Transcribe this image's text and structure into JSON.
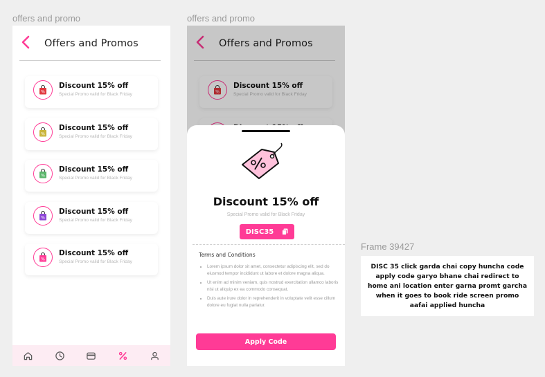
{
  "frames": {
    "left_label": "offers and promo",
    "middle_label": "offers and promo",
    "note_label": "Frame 39427"
  },
  "header": {
    "title": "Offers and Promos"
  },
  "promos": [
    {
      "title": "Discount 15% off",
      "subtitle": "Special Promo valid for Black Friday",
      "bag_color": "#e0383d",
      "bag_icon": "shopping-bag-icon"
    },
    {
      "title": "Discount 15% off",
      "subtitle": "Special Promo valid for Black Friday",
      "bag_color": "#c9b43a",
      "bag_icon": "shopping-bag-icon"
    },
    {
      "title": "Discount 15% off",
      "subtitle": "Special Promo valid for Black Friday",
      "bag_color": "#59b56a",
      "bag_icon": "shopping-bag-icon"
    },
    {
      "title": "Discount 15% off",
      "subtitle": "Special Promo valid for Black Friday",
      "bag_color": "#8e47d6",
      "bag_icon": "shopping-bag-icon"
    },
    {
      "title": "Discount 15% off",
      "subtitle": "Special Promo valid for Black Friday",
      "bag_color": "#ff3b96",
      "bag_icon": "shopping-bag-icon"
    }
  ],
  "bottom_nav": [
    {
      "icon": "home-icon",
      "active": false
    },
    {
      "icon": "clock-icon",
      "active": false
    },
    {
      "icon": "wallet-icon",
      "active": false
    },
    {
      "icon": "percent-icon",
      "active": true
    },
    {
      "icon": "profile-icon",
      "active": false
    }
  ],
  "sheet": {
    "icon": "discount-tag-icon",
    "title": "Discount 15% off",
    "subtitle": "Special Promo valid for Black Friday",
    "code": "DISC35",
    "terms_title": "Terms and Conditions",
    "terms": [
      "Lorem ipsum dolor sit amet, consectetur adipiscing elit, sed do eiusmod tempor incididunt ut labore et dolore magna aliqua.",
      "Ut enim ad minim veniam, quis nostrud exercitation ullamco laboris nisi ut aliquip ex ea commodo consequat.",
      "Duis aute irure dolor in reprehenderit in voluptate velit esse cillum dolore eu fugiat nulla pariatur."
    ],
    "apply_label": "Apply Code"
  },
  "note": {
    "text": "DISC 35 click garda chai copy huncha code apply code garyo bhane chai redirect to home ani location enter garna promt garcha when it goes to book ride screen promo aafai applied huncha"
  },
  "colors": {
    "accent": "#ff3b96",
    "nav_bg": "#fdecf3",
    "page_bg": "#efefef"
  }
}
